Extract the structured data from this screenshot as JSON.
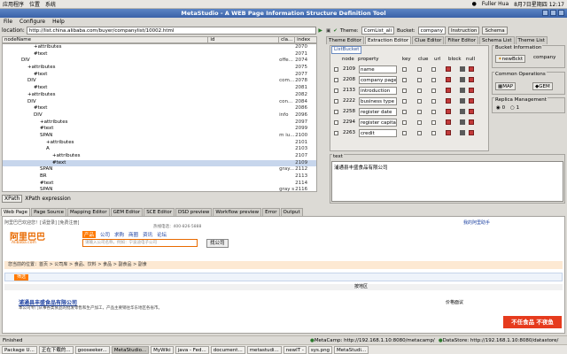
{
  "topbar": {
    "apps": "应用程序",
    "places": "位置",
    "system": "系统",
    "user": "Fuller Hua",
    "datetime": "8月7日星期四 12:17"
  },
  "window": {
    "title": "MetaStudio - A WEB Page Information Structure Definition Tool"
  },
  "menu": [
    "File",
    "Configure",
    "Help"
  ],
  "location": {
    "label": "location:",
    "url": "http://list.china.alibaba.com/buyer/companylist/10002.html"
  },
  "tree": {
    "columns": [
      "nodeName",
      "id",
      "cla...",
      "index"
    ],
    "rows": [
      {
        "indent": 5,
        "text": "+attributes",
        "id": "",
        "cls": "",
        "idx": "2070"
      },
      {
        "indent": 5,
        "text": "#text",
        "id": "",
        "cls": "",
        "idx": "2071"
      },
      {
        "indent": 3,
        "text": "DIV",
        "id": "",
        "cls": "offe...",
        "idx": "2074"
      },
      {
        "indent": 4,
        "text": "+attributes",
        "id": "",
        "cls": "",
        "idx": "2075"
      },
      {
        "indent": 5,
        "text": "#text",
        "id": "",
        "cls": "",
        "idx": "2077"
      },
      {
        "indent": 4,
        "text": "DIV",
        "id": "",
        "cls": "com...",
        "idx": "2078"
      },
      {
        "indent": 5,
        "text": "#text",
        "id": "",
        "cls": "",
        "idx": "2081"
      },
      {
        "indent": 4,
        "text": "+attributes",
        "id": "",
        "cls": "",
        "idx": "2082"
      },
      {
        "indent": 4,
        "text": "DIV",
        "id": "",
        "cls": "con...",
        "idx": "2084"
      },
      {
        "indent": 5,
        "text": "#text",
        "id": "",
        "cls": "",
        "idx": "2086"
      },
      {
        "indent": 5,
        "text": "DIV",
        "id": "",
        "cls": "info",
        "idx": "2096"
      },
      {
        "indent": 6,
        "text": "+attributes",
        "id": "",
        "cls": "",
        "idx": "2097"
      },
      {
        "indent": 6,
        "text": "#text",
        "id": "",
        "cls": "",
        "idx": "2099"
      },
      {
        "indent": 6,
        "text": "SPAN",
        "id": "",
        "cls": "m iu...",
        "idx": "2100"
      },
      {
        "indent": 7,
        "text": "+attributes",
        "id": "",
        "cls": "",
        "idx": "2101"
      },
      {
        "indent": 7,
        "text": "A",
        "id": "",
        "cls": "",
        "idx": "2103"
      },
      {
        "indent": 8,
        "text": "+attributes",
        "id": "",
        "cls": "",
        "idx": "2107"
      },
      {
        "indent": 8,
        "text": "#text",
        "id": "",
        "cls": "",
        "idx": "2109",
        "sel": true
      },
      {
        "indent": 6,
        "text": "SPAN",
        "id": "",
        "cls": "gray...",
        "idx": "2112"
      },
      {
        "indent": 6,
        "text": "BR",
        "id": "",
        "cls": "",
        "idx": "2113"
      },
      {
        "indent": 6,
        "text": "#text",
        "id": "",
        "cls": "",
        "idx": "2114"
      },
      {
        "indent": 6,
        "text": "SPAN",
        "id": "",
        "cls": "gray s",
        "idx": "2116"
      }
    ]
  },
  "xpath": {
    "button": "XPath",
    "label": "XPath expression"
  },
  "right": {
    "theme_label": "Theme:",
    "theme": "ComList_ali",
    "bucket_label": "Bucket:",
    "bucket": "company",
    "instruction": "Instruction",
    "schema": "Schema"
  },
  "rtabs": [
    "Theme Editor",
    "Extraction Editor",
    "Clue Editor",
    "Filter Editor",
    "Schema List",
    "Theme List"
  ],
  "listbucket": {
    "tab": "ListBucket",
    "headers": [
      "node",
      "property",
      "key",
      "clue",
      "url",
      "block",
      "null"
    ],
    "rows": [
      {
        "node": "2109",
        "prop": "name"
      },
      {
        "node": "2208",
        "prop": "company page"
      },
      {
        "node": "2133",
        "prop": "introduction"
      },
      {
        "node": "2222",
        "prop": "business type"
      },
      {
        "node": "2258",
        "prop": "register date"
      },
      {
        "node": "2294",
        "prop": "register capital"
      },
      {
        "node": "2263",
        "prop": "credit"
      }
    ]
  },
  "bucketinfo": {
    "title": "Bucket Information",
    "newbucket": "newBckt",
    "name": "company"
  },
  "commonops": {
    "title": "Common Operations",
    "map": "MAP",
    "gem": "GEM"
  },
  "replica": {
    "title": "Replica Management",
    "r0": "0",
    "r1": "1"
  },
  "textgrp": {
    "title": "text",
    "value": "浦通县丰盛食品有限公司"
  },
  "btabs": [
    "Web Page",
    "Page Source",
    "Mapping Editor",
    "GEM Editor",
    "SCE Editor",
    "DSD preview",
    "Workflow preview",
    "Error",
    "Output"
  ],
  "web": {
    "welcome": "阿里巴巴欢迎您！[请登录] [免费注册]",
    "mylink": "我的阿里助手",
    "logo": "阿里巴巴",
    "logo_sub": "Alibaba.com",
    "nav": [
      "产品",
      "公司",
      "求购",
      "商圈",
      "资讯",
      "论坛"
    ],
    "search_hint": "请输入公司名称，例如：宁波迪电子公司",
    "search_btn": "找公司",
    "hotline": "热线电话：400-826-5888",
    "breadcrumb": "您当前的位置：首页 > 公司库 > 食品、饮料 > 食品 > 副食品 > 副食",
    "filter_btn": "筛选",
    "sort_label": "按地区",
    "company_name": "浦通县丰盛食品有限公司",
    "company_desc": "本公司专门从事各类食品的批发零售和生产加工，产品主要销往华东地区各省市。",
    "price": "价格面议",
    "promo": "不任食品 不夜鱼"
  },
  "status": {
    "left": "Finished",
    "metacamp": "MetaCamp: http://192.168.1.10:8080/metacamp/",
    "datastore": "DataStore: http://192.168.1.10:8080/datastore/"
  },
  "taskbar": [
    "Package U...",
    "正在下载的...",
    "gooseeker...",
    "MetaStudio...",
    "MyWiki",
    "java - Fed...",
    "document...",
    "metastudi...",
    "newIT -",
    "sys.png",
    "MetaStudi..."
  ],
  "colors": {
    "title_bar": "#3a62a8",
    "accent": "#ff7a00",
    "selected_row": "#c7d6ec"
  }
}
